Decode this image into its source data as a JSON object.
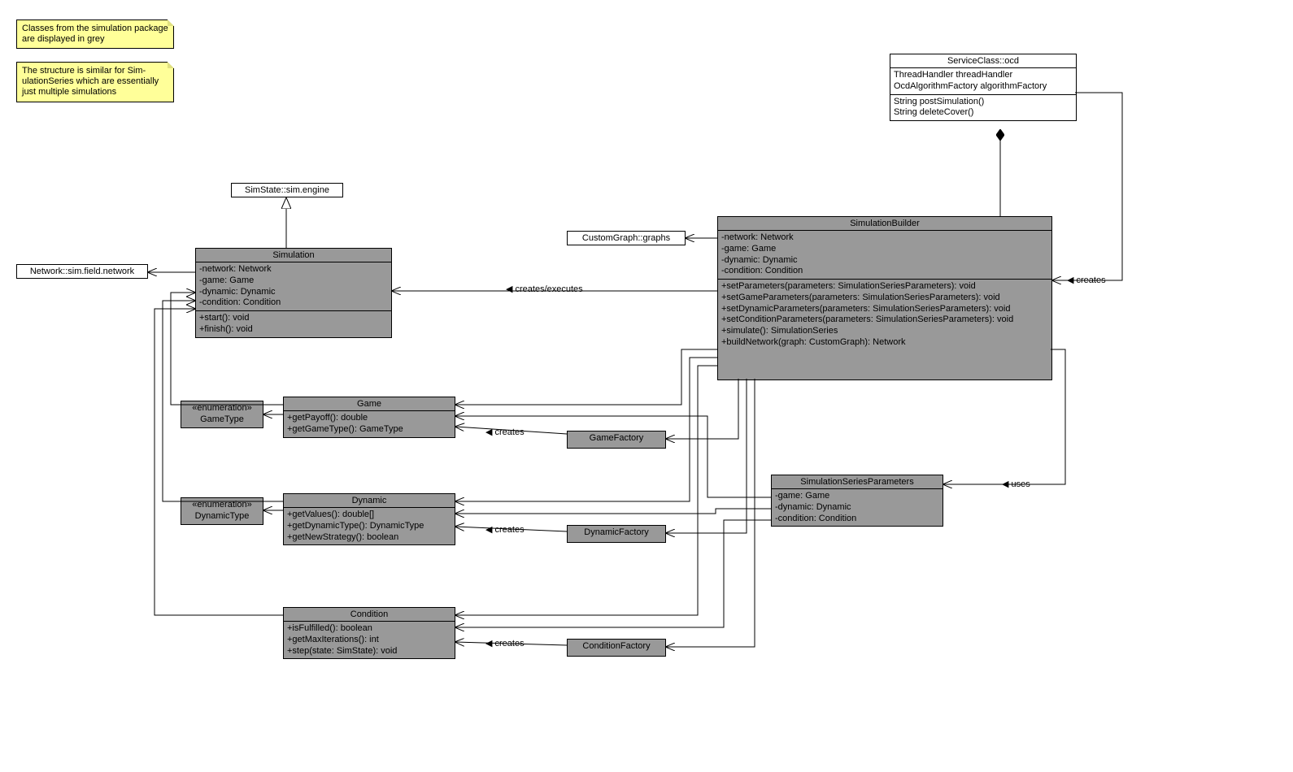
{
  "notes": {
    "n1": "Classes from the simulation package are displayed in grey",
    "n2": "The structure is similar for Sim-ulationSeries which are essentially just multiple simulations"
  },
  "labels": {
    "creates_executes": "◀ creates/executes",
    "creates": "◀ creates",
    "creates_r": "◀ creates",
    "uses": "◀ uses"
  },
  "classes": {
    "simstate": {
      "title": "SimState::sim.engine"
    },
    "network_ext": {
      "title": "Network::sim.field.network"
    },
    "customgraph": {
      "title": "CustomGraph::graphs"
    },
    "serviceclass": {
      "title": "ServiceClass::ocd",
      "attrs": [
        "ThreadHandler threadHandler",
        "OcdAlgorithmFactory algorithmFactory"
      ],
      "ops": [
        "String postSimulation()",
        "String deleteCover()"
      ]
    },
    "simulation": {
      "title": "Simulation",
      "attrs": [
        "-network: Network",
        "-game: Game",
        "-dynamic: Dynamic",
        "-condition: Condition"
      ],
      "ops": [
        "+start(): void",
        "+finish(): void"
      ]
    },
    "simulationbuilder": {
      "title": "SimulationBuilder",
      "attrs": [
        "-network: Network",
        "-game: Game",
        "-dynamic: Dynamic",
        "-condition: Condition"
      ],
      "ops": [
        "+setParameters(parameters: SimulationSeriesParameters): void",
        "+setGameParameters(parameters: SimulationSeriesParameters): void",
        "+setDynamicParameters(parameters: SimulationSeriesParameters): void",
        "+setConditionParameters(parameters: SimulationSeriesParameters): void",
        "+simulate(): SimulationSeries",
        "+buildNetwork(graph: CustomGraph): Network"
      ]
    },
    "game": {
      "title": "Game",
      "ops": [
        "+getPayoff(): double",
        "+getGameType(): GameType"
      ]
    },
    "gametype": {
      "stereo": "«enumeration»",
      "title": "GameType"
    },
    "gamefactory": {
      "title": "GameFactory"
    },
    "dynamic": {
      "title": "Dynamic",
      "ops": [
        "+getValues(): double[]",
        "+getDynamicType(): DynamicType",
        "+getNewStrategy(): boolean"
      ]
    },
    "dynamictype": {
      "stereo": "«enumeration»",
      "title": "DynamicType"
    },
    "dynamicfactory": {
      "title": "DynamicFactory"
    },
    "condition": {
      "title": "Condition",
      "ops": [
        "+isFulfilled(): boolean",
        "+getMaxIterations(): int",
        "+step(state: SimState): void"
      ]
    },
    "conditionfactory": {
      "title": "ConditionFactory"
    },
    "ssp": {
      "title": "SimulationSeriesParameters",
      "attrs": [
        "-game: Game",
        "-dynamic: Dynamic",
        "-condition: Condition"
      ]
    }
  }
}
